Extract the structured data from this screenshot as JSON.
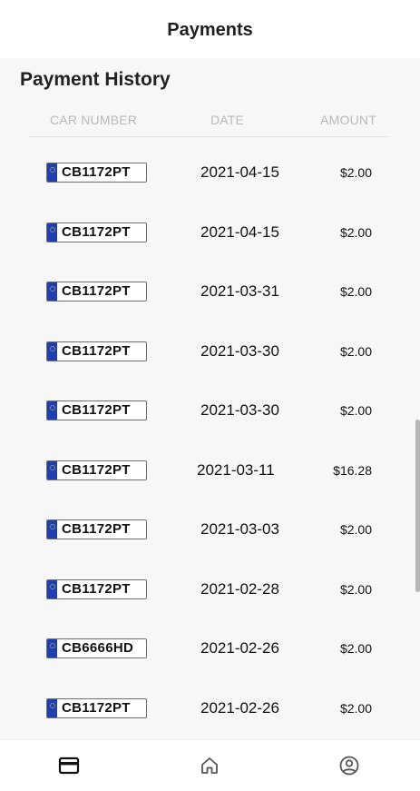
{
  "header": {
    "title": "Payments"
  },
  "section": {
    "title": "Payment History"
  },
  "columns": {
    "car_number": "CAR NUMBER",
    "date": "DATE",
    "amount": "AMOUNT"
  },
  "payments": [
    {
      "plate": "CB1172PT",
      "date": "2021-04-15",
      "amount": "$2.00"
    },
    {
      "plate": "CB1172PT",
      "date": "2021-04-15",
      "amount": "$2.00"
    },
    {
      "plate": "CB1172PT",
      "date": "2021-03-31",
      "amount": "$2.00"
    },
    {
      "plate": "CB1172PT",
      "date": "2021-03-30",
      "amount": "$2.00"
    },
    {
      "plate": "CB1172PT",
      "date": "2021-03-30",
      "amount": "$2.00"
    },
    {
      "plate": "CB1172PT",
      "date": "2021-03-11",
      "amount": "$16.28"
    },
    {
      "plate": "CB1172PT",
      "date": "2021-03-03",
      "amount": "$2.00"
    },
    {
      "plate": "CB1172PT",
      "date": "2021-02-28",
      "amount": "$2.00"
    },
    {
      "plate": "CB6666HD",
      "date": "2021-02-26",
      "amount": "$2.00"
    },
    {
      "plate": "CB1172PT",
      "date": "2021-02-26",
      "amount": "$2.00"
    }
  ],
  "nav": {
    "items": [
      {
        "icon": "credit-card-icon",
        "active": true
      },
      {
        "icon": "home-icon",
        "active": false
      },
      {
        "icon": "account-circle-icon",
        "active": false
      }
    ]
  },
  "colors": {
    "plate_blue": "#1f3fae",
    "header_text": "#b9b9b9",
    "content_bg": "#f7f7f7"
  }
}
